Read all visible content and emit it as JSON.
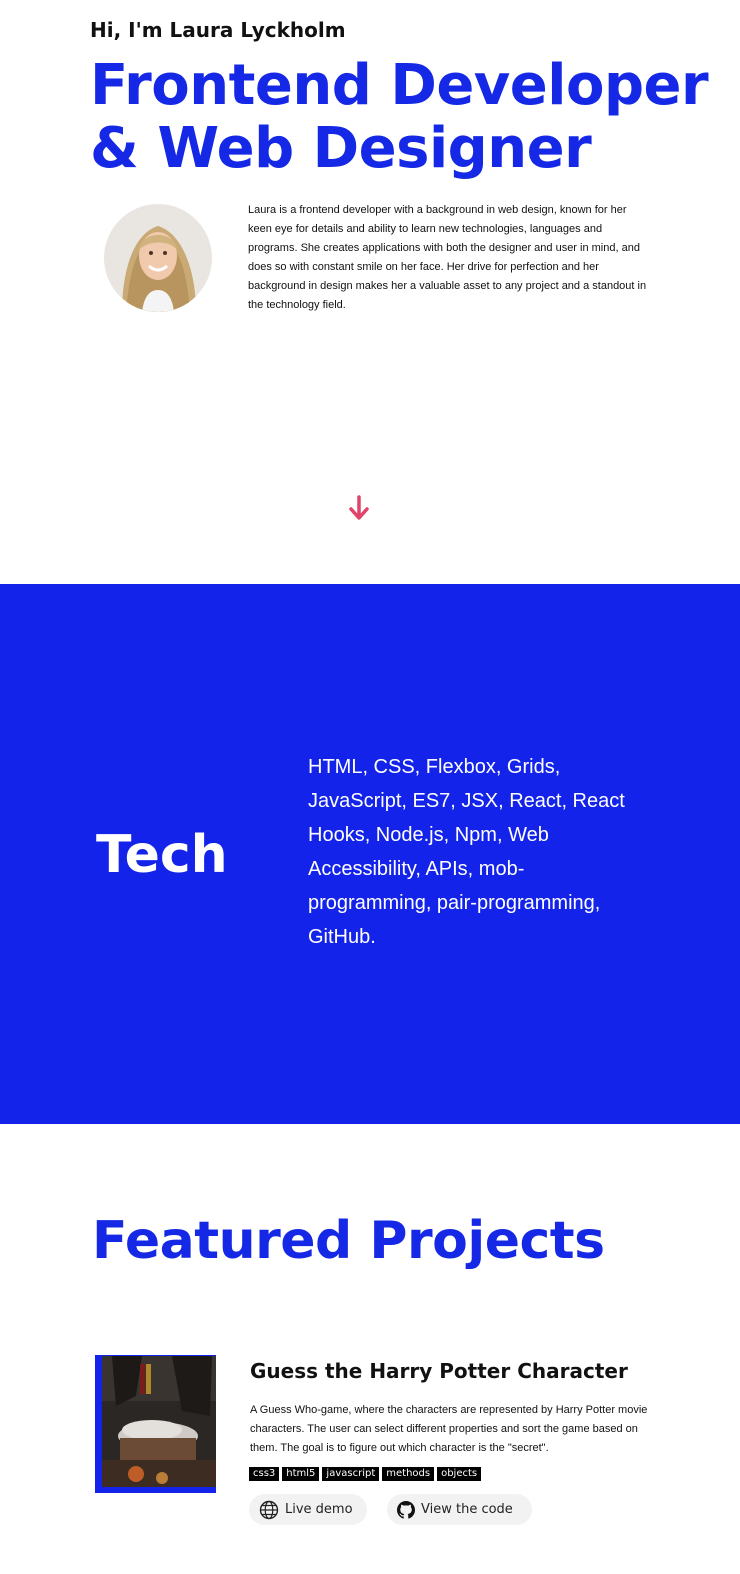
{
  "hero": {
    "greeting": "Hi, I'm Laura Lyckholm",
    "headline_line1": "Frontend Developer",
    "headline_line2": "& Web Designer",
    "bio": "Laura is a frontend developer with a background in web design, known for her keen eye for details and ability to learn new technologies, languages and programs. She creates applications with both the designer and user in mind, and does so with constant smile on her face. Her drive for perfection and her background in design makes her a valuable asset to any project and a standout in the technology field.",
    "avatar_icon": "profile-photo",
    "scroll_icon": "arrow-down-icon"
  },
  "tech": {
    "title": "Tech",
    "list": "HTML, CSS, Flexbox, Grids, JavaScript, ES7, JSX, React, React Hooks, Node.js, Npm, Web Accessibility, APIs, mob-programming, pair-programming, GitHub."
  },
  "featured": {
    "title": "Featured Projects",
    "projects": [
      {
        "title": "Guess the Harry Potter Character",
        "description": "A Guess Who-game, where the characters are represented by Harry Potter movie characters. The user can select different properties and sort the game based on them. The goal is to figure out which character is the \"secret\".",
        "tags": [
          "css3",
          "html5",
          "javascript",
          "methods",
          "objects"
        ],
        "demo_label": "Live demo",
        "code_label": "View the code"
      }
    ]
  },
  "colors": {
    "accent_blue": "#1428e6",
    "arrow_pink": "#e0446a"
  }
}
